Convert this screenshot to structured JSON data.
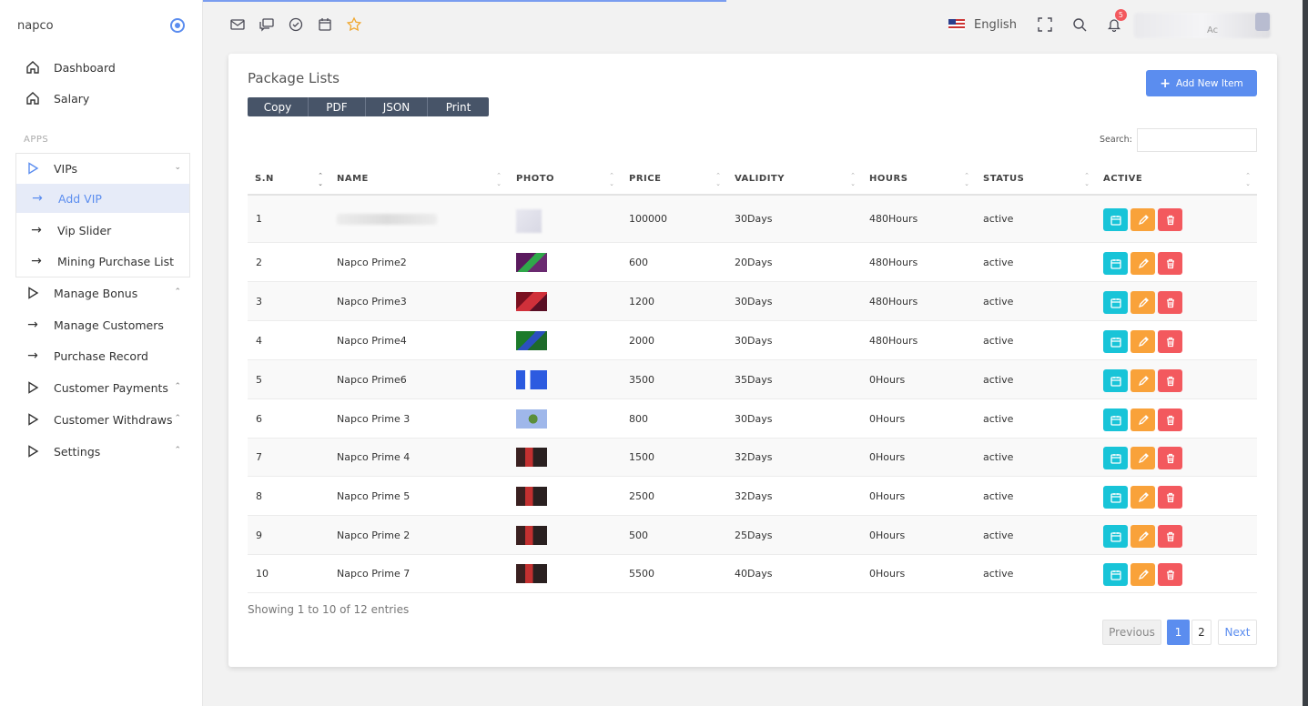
{
  "sidebar": {
    "brand": "napco",
    "apps_label": "APPS",
    "items": [
      {
        "label": "Dashboard",
        "icon": "home-icon"
      },
      {
        "label": "Salary",
        "icon": "home-icon"
      },
      {
        "label": "VIPs",
        "icon": "triangle-right-icon"
      },
      {
        "label": "Add VIP",
        "icon": "arrow-right-icon"
      },
      {
        "label": "Vip Slider",
        "icon": "arrow-right-icon"
      },
      {
        "label": "Mining Purchase List",
        "icon": "arrow-right-icon"
      },
      {
        "label": "Manage Bonus",
        "icon": "triangle-right-icon"
      },
      {
        "label": "Manage Customers",
        "icon": "arrow-right-icon"
      },
      {
        "label": "Purchase Record",
        "icon": "arrow-right-icon"
      },
      {
        "label": "Customer Payments",
        "icon": "triangle-right-icon"
      },
      {
        "label": "Customer Withdraws",
        "icon": "triangle-right-icon"
      },
      {
        "label": "Settings",
        "icon": "triangle-right-icon"
      }
    ]
  },
  "header": {
    "language": "English",
    "notification_count": "5",
    "user_initials": "Ac"
  },
  "card": {
    "title": "Package Lists",
    "export_buttons": [
      "Copy",
      "PDF",
      "JSON",
      "Print"
    ],
    "add_button": "Add New Item",
    "search_label": "Search:",
    "search_value": "",
    "columns": [
      "S.N",
      "NAME",
      "PHOTO",
      "PRICE",
      "VALIDITY",
      "HOURS",
      "STATUS",
      "ACTIVE"
    ],
    "rows": [
      {
        "sn": "1",
        "name": "",
        "price": "100000",
        "validity": "30Days",
        "hours": "480Hours",
        "status": "active"
      },
      {
        "sn": "2",
        "name": "Napco Prime2",
        "price": "600",
        "validity": "20Days",
        "hours": "480Hours",
        "status": "active"
      },
      {
        "sn": "3",
        "name": "Napco Prime3",
        "price": "1200",
        "validity": "30Days",
        "hours": "480Hours",
        "status": "active"
      },
      {
        "sn": "4",
        "name": "Napco Prime4",
        "price": "2000",
        "validity": "30Days",
        "hours": "480Hours",
        "status": "active"
      },
      {
        "sn": "5",
        "name": "Napco Prime6",
        "price": "3500",
        "validity": "35Days",
        "hours": "0Hours",
        "status": "active"
      },
      {
        "sn": "6",
        "name": "Napco Prime 3",
        "price": "800",
        "validity": "30Days",
        "hours": "0Hours",
        "status": "active"
      },
      {
        "sn": "7",
        "name": "Napco Prime 4",
        "price": "1500",
        "validity": "32Days",
        "hours": "0Hours",
        "status": "active"
      },
      {
        "sn": "8",
        "name": "Napco Prime 5",
        "price": "2500",
        "validity": "32Days",
        "hours": "0Hours",
        "status": "active"
      },
      {
        "sn": "9",
        "name": "Napco Prime 2",
        "price": "500",
        "validity": "25Days",
        "hours": "0Hours",
        "status": "active"
      },
      {
        "sn": "10",
        "name": "Napco Prime 7",
        "price": "5500",
        "validity": "40Days",
        "hours": "0Hours",
        "status": "active"
      }
    ],
    "info": "Showing 1 to 10 of 12 entries",
    "pagination": {
      "previous": "Previous",
      "pages": [
        "1",
        "2"
      ],
      "next": "Next",
      "current": "1"
    }
  },
  "colors": {
    "accent": "#5b8def",
    "view": "#18c4d8",
    "edit": "#f9a23a",
    "delete": "#f3595e",
    "export_bar": "#475468"
  }
}
